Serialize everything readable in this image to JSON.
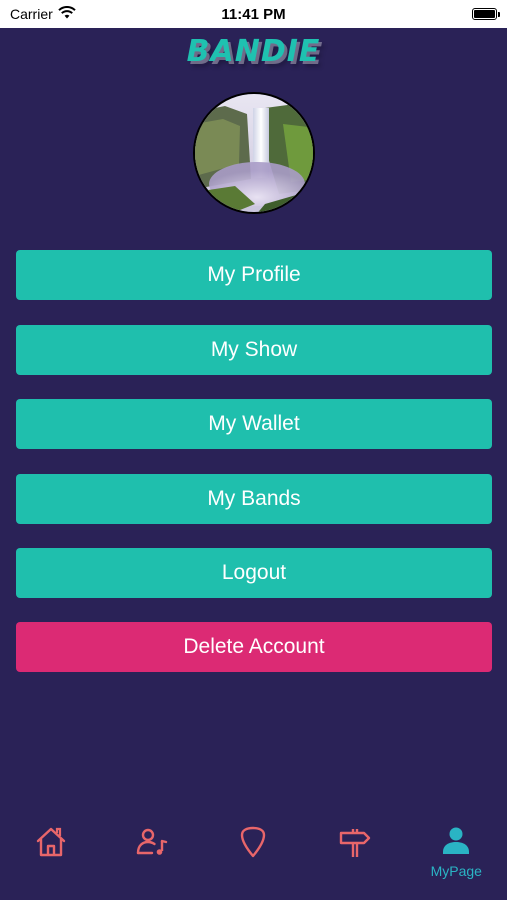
{
  "status_bar": {
    "carrier": "Carrier",
    "time": "11:41 PM"
  },
  "app": {
    "logo": "BANDIE"
  },
  "menu": {
    "my_profile": "My Profile",
    "my_show": "My Show",
    "my_wallet": "My Wallet",
    "my_bands": "My Bands",
    "logout": "Logout",
    "delete_account": "Delete Account"
  },
  "tabs": [
    {
      "icon": "home-icon",
      "label": ""
    },
    {
      "icon": "musician-icon",
      "label": ""
    },
    {
      "icon": "guitar-pick-icon",
      "label": ""
    },
    {
      "icon": "signpost-icon",
      "label": ""
    },
    {
      "icon": "person-icon",
      "label": "MyPage",
      "active": true
    }
  ],
  "colors": {
    "background": "#2a2257",
    "accent": "#1fbfad",
    "danger": "#dc2a74",
    "tab_inactive": "#e8666a",
    "tab_active": "#2ab4c4"
  }
}
